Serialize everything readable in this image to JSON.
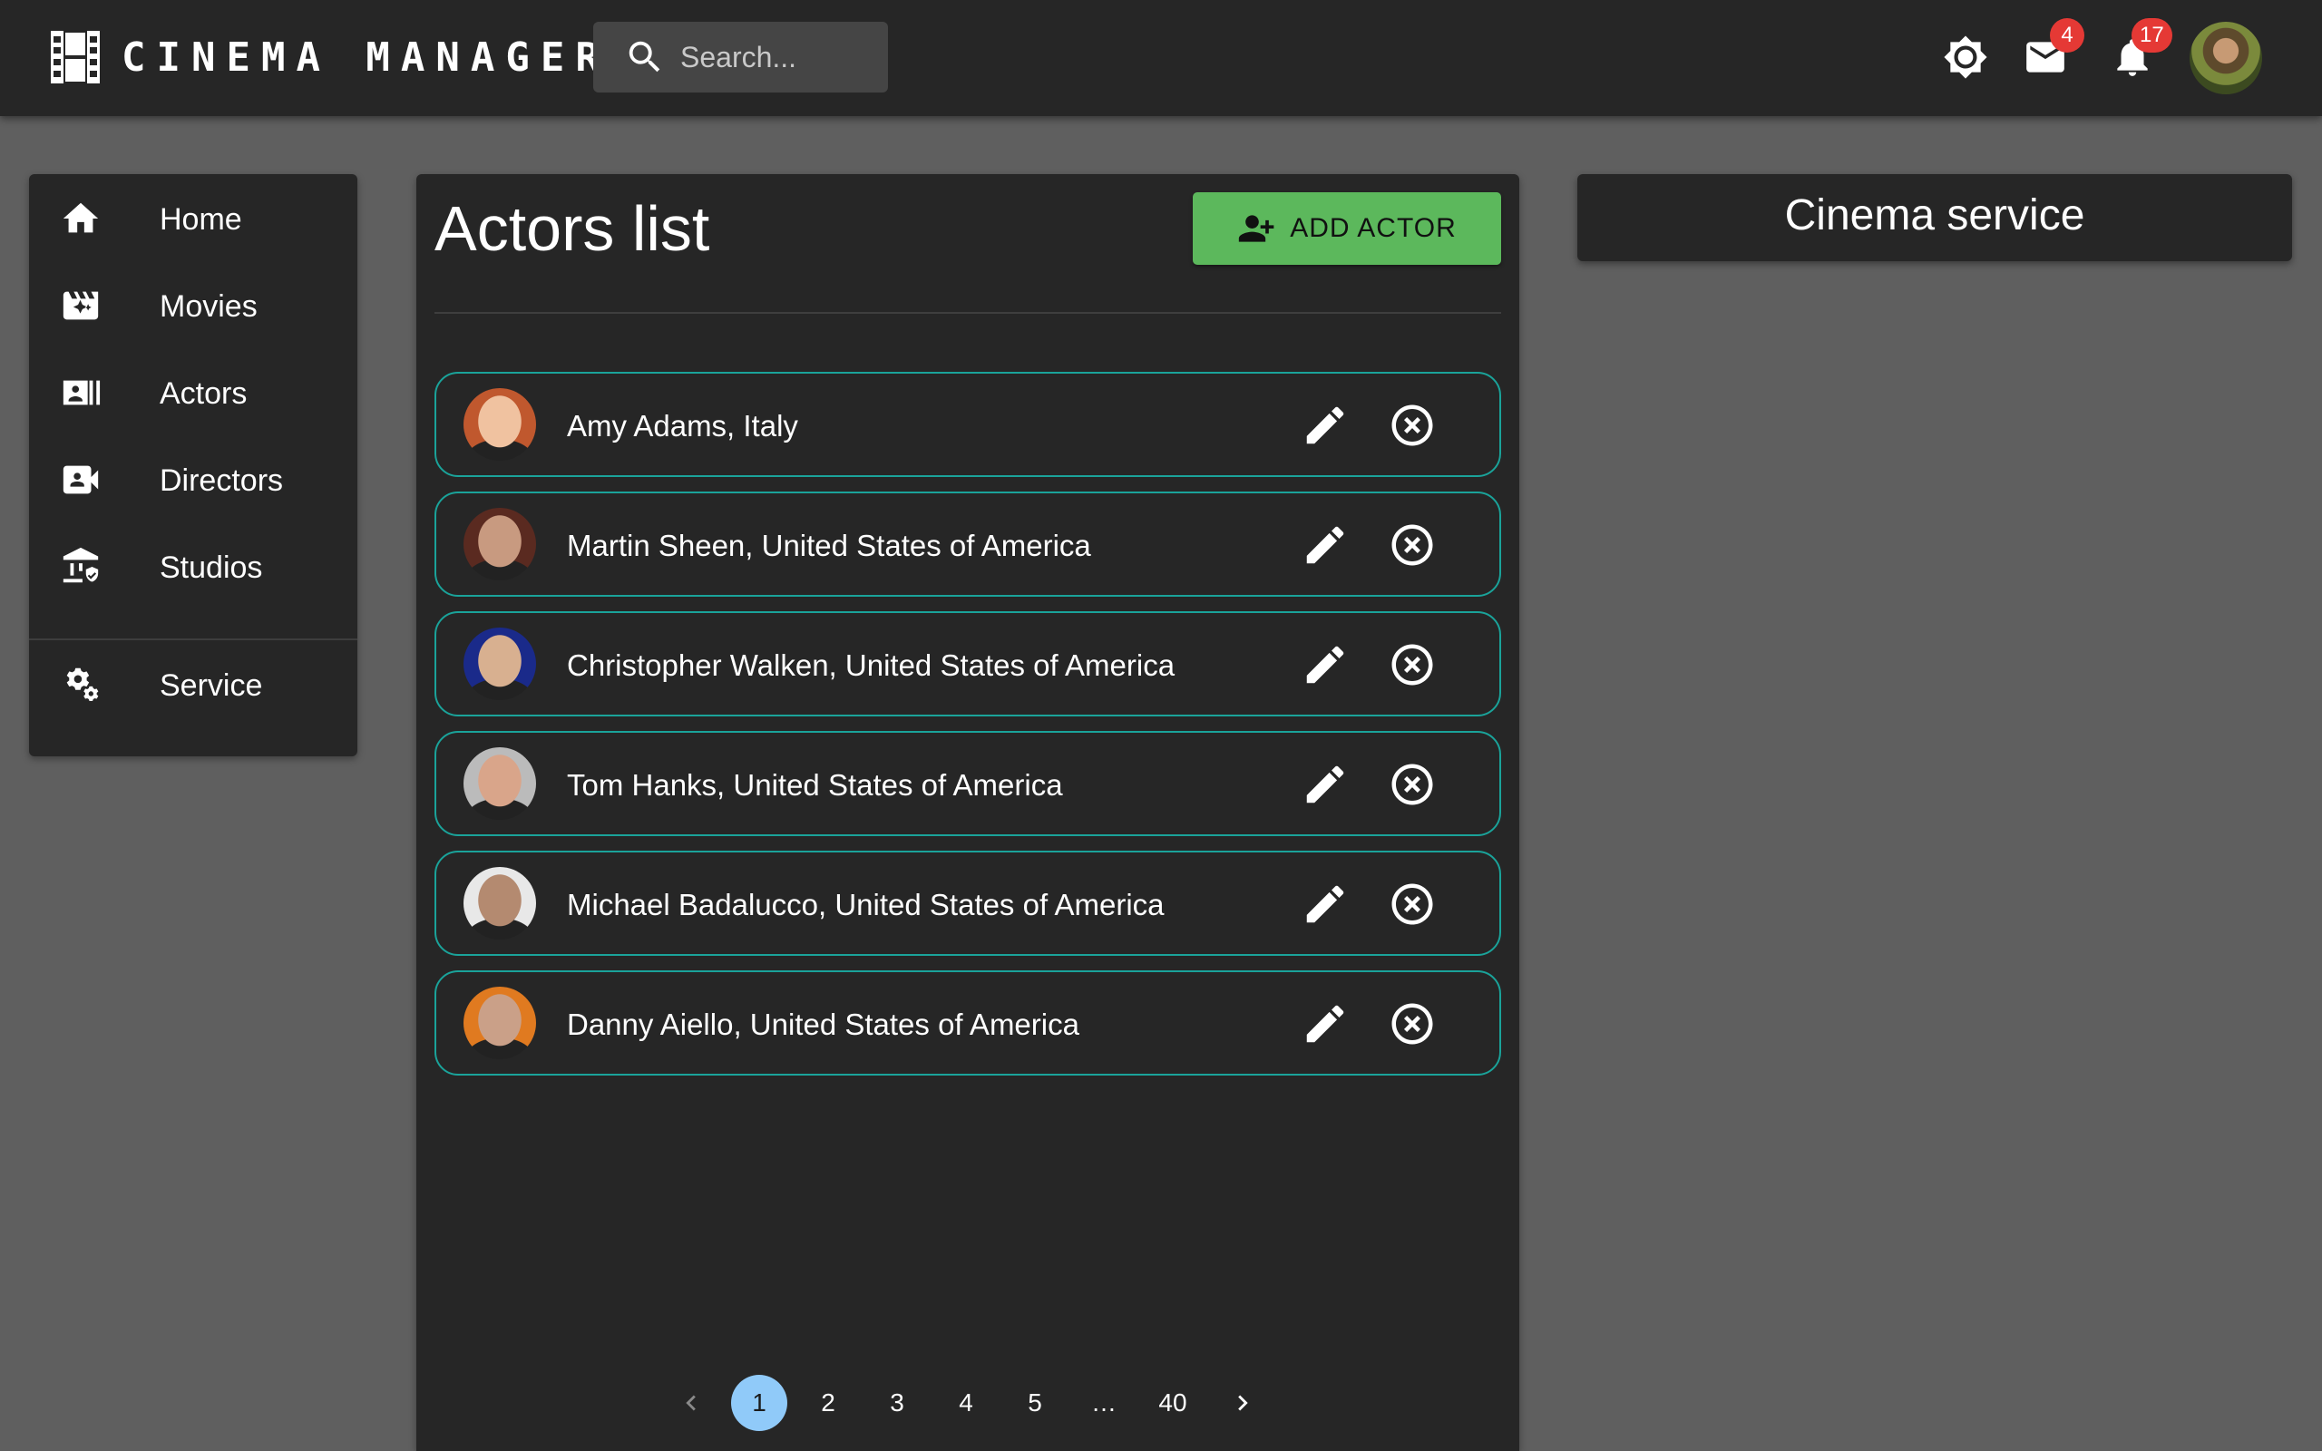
{
  "header": {
    "app_title": "CINEMA MANAGER",
    "search_placeholder": "Search...",
    "mail_badge": "4",
    "notifications_badge": "17"
  },
  "sidebar": {
    "items": [
      {
        "label": "Home",
        "icon": "home-icon"
      },
      {
        "label": "Movies",
        "icon": "movies-icon"
      },
      {
        "label": "Actors",
        "icon": "actors-icon"
      },
      {
        "label": "Directors",
        "icon": "directors-icon"
      },
      {
        "label": "Studios",
        "icon": "studios-icon"
      },
      {
        "label": "Service",
        "icon": "service-icon"
      }
    ]
  },
  "main": {
    "title": "Actors list",
    "add_button_label": "ADD ACTOR",
    "actors": [
      {
        "label": "Amy Adams, Italy",
        "avatar_colors": [
          "#c0582e",
          "#f0c2a0"
        ]
      },
      {
        "label": "Martin Sheen, United States of America",
        "avatar_colors": [
          "#5a2a20",
          "#c89a80"
        ]
      },
      {
        "label": "Christopher Walken, United States of America",
        "avatar_colors": [
          "#1a2a8a",
          "#d8b090"
        ]
      },
      {
        "label": "Tom Hanks, United States of America",
        "avatar_colors": [
          "#bbbbbb",
          "#d9a58a"
        ]
      },
      {
        "label": "Michael Badalucco, United States of America",
        "avatar_colors": [
          "#e8e8e8",
          "#b48a70"
        ]
      },
      {
        "label": "Danny Aiello, United States of America",
        "avatar_colors": [
          "#e07a20",
          "#caa088"
        ]
      }
    ],
    "pagination": {
      "pages": [
        "1",
        "2",
        "3",
        "4",
        "5"
      ],
      "ellipsis": "…",
      "last_page": "40",
      "current": "1"
    }
  },
  "service_panel": {
    "title": "Cinema service"
  },
  "colors": {
    "background": "#5f5f5f",
    "surface": "#262626",
    "accent_green": "#5cb85c",
    "row_border": "#1aa39a",
    "badge_red": "#e53935",
    "active_page": "#90caf9"
  }
}
